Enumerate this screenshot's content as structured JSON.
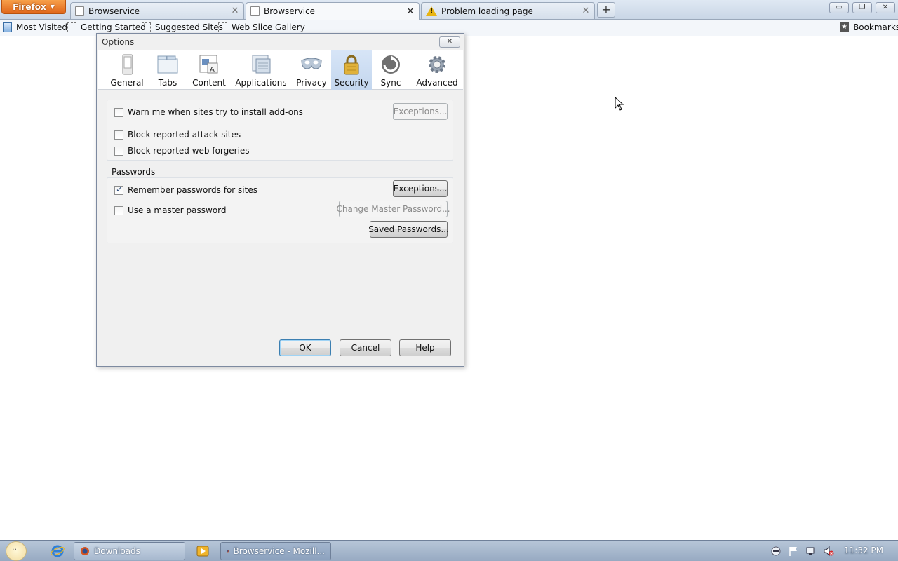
{
  "browser": {
    "app_button": "Firefox",
    "tabs": [
      {
        "label": "Browservice",
        "icon": "page-icon",
        "selected": false
      },
      {
        "label": "Browservice",
        "icon": "page-icon",
        "selected": true
      },
      {
        "label": "Problem loading page",
        "icon": "warning-icon",
        "selected": false
      }
    ],
    "new_tab_symbol": "+",
    "window_controls": {
      "minimize": "▭",
      "restore": "❐",
      "close": "✕"
    }
  },
  "bookmarks_bar": {
    "items": [
      {
        "label": "Most Visited"
      },
      {
        "label": "Getting Started"
      },
      {
        "label": "Suggested Sites"
      },
      {
        "label": "Web Slice Gallery"
      }
    ],
    "bookmarks_label": "Bookmarks"
  },
  "options_dialog": {
    "title": "Options",
    "close_symbol": "✕",
    "panes": [
      {
        "label": "General",
        "icon": "general-icon"
      },
      {
        "label": "Tabs",
        "icon": "tabs-icon"
      },
      {
        "label": "Content",
        "icon": "content-icon"
      },
      {
        "label": "Applications",
        "icon": "applications-icon"
      },
      {
        "label": "Privacy",
        "icon": "privacy-mask-icon"
      },
      {
        "label": "Security",
        "icon": "padlock-icon",
        "selected": true
      },
      {
        "label": "Sync",
        "icon": "sync-icon"
      },
      {
        "label": "Advanced",
        "icon": "gear-icon"
      }
    ],
    "security": {
      "warn_addons": {
        "label": "Warn me when sites try to install add-ons",
        "checked": false
      },
      "addons_exceptions": {
        "label": "Exceptions...",
        "enabled": false
      },
      "block_attack": {
        "label": "Block reported attack sites",
        "checked": false
      },
      "block_forgeries": {
        "label": "Block reported web forgeries",
        "checked": false
      }
    },
    "passwords": {
      "caption": "Passwords",
      "remember": {
        "label": "Remember passwords for sites",
        "checked": true
      },
      "exceptions": {
        "label": "Exceptions...",
        "enabled": true
      },
      "master": {
        "label": "Use a master password",
        "checked": false
      },
      "change_master": {
        "label": "Change Master Password...",
        "enabled": false
      },
      "saved": {
        "label": "Saved Passwords...",
        "enabled": true
      }
    },
    "buttons": {
      "ok": "OK",
      "cancel": "Cancel",
      "help": "Help"
    }
  },
  "taskbar": {
    "items": [
      {
        "label": "Downloads",
        "active": false
      },
      {
        "label": "Browservice - Mozill...",
        "active": true
      }
    ],
    "clock": "11:32 PM"
  }
}
